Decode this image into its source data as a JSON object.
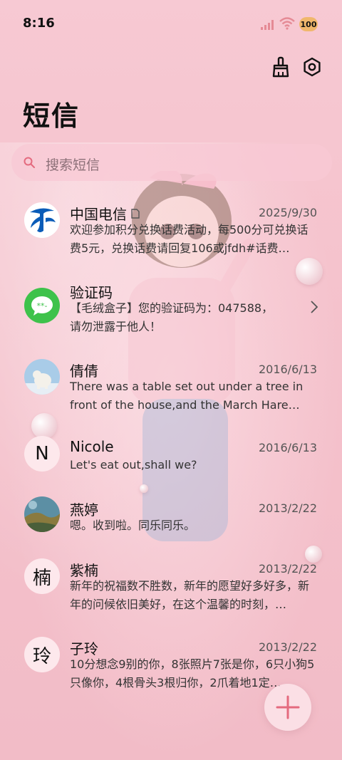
{
  "status_bar": {
    "time": "8:16",
    "battery": "100"
  },
  "header": {
    "title": "短信"
  },
  "search": {
    "placeholder": "搜索短信"
  },
  "conversations": [
    {
      "name": "中国电信",
      "date": "2025/9/30",
      "preview": "欢迎参加积分兑换话费活动，每500分可兑换话费5元，兑换话费请回复106或jfdh#话费…",
      "avatar": "china-telecom-logo"
    },
    {
      "name": "验证码",
      "date": "",
      "preview": "【毛绒盒子】您的验证码为：047588，请勿泄露于他人！",
      "avatar": "message-bubble-icon"
    },
    {
      "name": "倩倩",
      "date": "2016/6/13",
      "preview": "There was a table set out under a tree in front of the house,and the March Hare an…",
      "avatar": "polar-bear-photo"
    },
    {
      "name": "Nicole",
      "date": "2016/6/13",
      "preview": "Let's eat out,shall we?",
      "avatar_letter": "N"
    },
    {
      "name": "燕婷",
      "date": "2013/2/22",
      "preview": "嗯。收到啦。同乐同乐。",
      "avatar": "landscape-photo"
    },
    {
      "name": "紫楠",
      "date": "2013/2/22",
      "preview": "新年的祝福数不胜数，新年的愿望好多好多，新年的问候依旧美好，在这个温馨的时刻，…",
      "avatar_letter": "楠"
    },
    {
      "name": "子玲",
      "date": "2013/2/22",
      "preview": "10分想念9别的你，8张照片7张是你，6只小狗5只像你，4根骨头3根归你，2爪着地1定…",
      "avatar_letter": "玲"
    }
  ],
  "colors": {
    "accent": "#e46a7e",
    "telecom_blue": "#0a5cb8",
    "verify_green": "#3ec24b"
  }
}
